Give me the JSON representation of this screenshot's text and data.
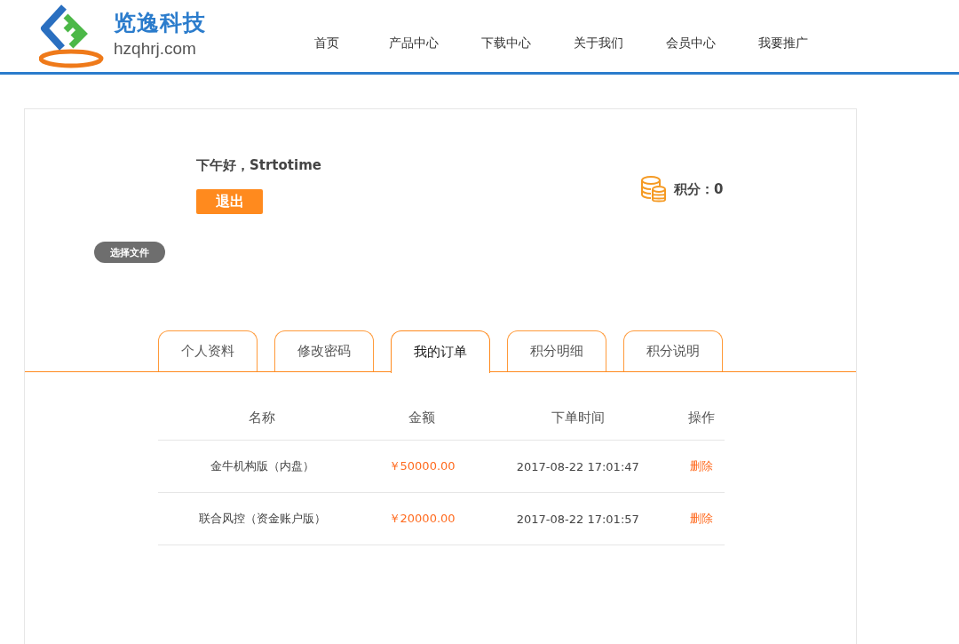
{
  "logo": {
    "name": "览逸科技",
    "domain": "hzqhrj.com"
  },
  "nav": [
    "首页",
    "产品中心",
    "下载中心",
    "关于我们",
    "会员中心",
    "我要推广"
  ],
  "greeting": "下午好，Strtotime",
  "logout_button": "退出",
  "points": "积分：0",
  "file_button": "选择文件",
  "tabs": [
    {
      "label": "个人资料",
      "selected": false
    },
    {
      "label": "修改密码",
      "selected": false
    },
    {
      "label": "我的订单",
      "selected": true
    },
    {
      "label": "积分明细",
      "selected": false
    },
    {
      "label": "积分说明",
      "selected": false
    }
  ],
  "table": {
    "columns": [
      "名称",
      "金额",
      "下单时间",
      "操作"
    ],
    "rows": [
      {
        "name": "金牛机构版（内盘）",
        "amount": "￥50000.00",
        "time": "2017-08-22 17:01:47",
        "action": "删除"
      },
      {
        "name": "联合风控（资金账户版）",
        "amount": "￥20000.00",
        "time": "2017-08-22 17:01:57",
        "action": "删除"
      }
    ]
  }
}
